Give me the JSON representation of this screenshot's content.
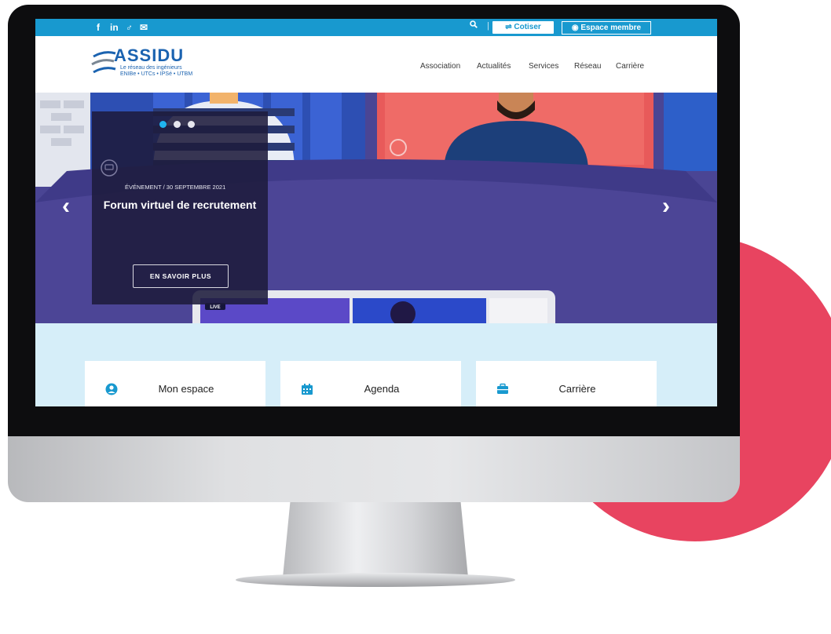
{
  "topbar": {
    "social": [
      "f",
      "in",
      "♂",
      "✉"
    ],
    "cotiser_label": "Cotiser",
    "espace_label": "Espace membre"
  },
  "logo": {
    "title": "ASSIDU",
    "subtitle": "Le réseau des ingénieurs",
    "schools": "ENIBe • UTCs • IPSé • UTBM"
  },
  "nav": [
    "Association",
    "Actualités",
    "Services",
    "Réseau",
    "Carrière"
  ],
  "hero": {
    "meta": "ÉVÉNEMENT /  30 SEPTEMBRE 2021",
    "title": "Forum virtuel de recrutement",
    "button": "EN SAVOIR PLUS",
    "live": "LIVE"
  },
  "quick_links": [
    "Mon espace",
    "Agenda",
    "Carrière"
  ],
  "colors": {
    "primary": "#1899cf",
    "hero": "#4a4594",
    "accent": "#e84460"
  }
}
